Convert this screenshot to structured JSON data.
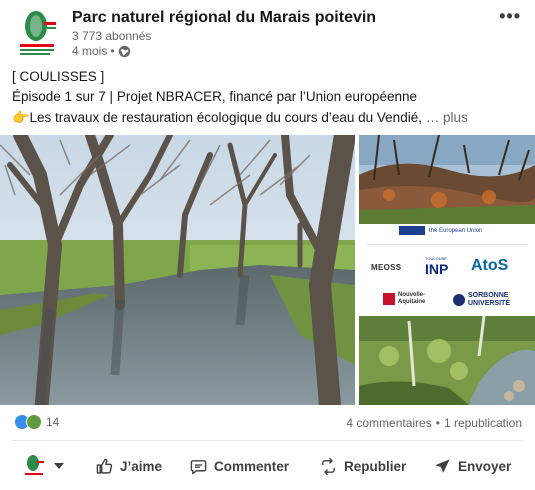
{
  "post": {
    "author": "Parc naturel régional du Marais poitevin",
    "followers": "3 773 abonnés",
    "age": "4 mois",
    "age_sep": "•",
    "more_label": "•••",
    "text_lines": [
      "[ COULISSES ]",
      "Épisode 1 sur 7 | Projet NBRACER, financé par l’Union européenne"
    ],
    "text_line3_emoji": "👉",
    "text_line3": "Les travaux de restauration écologique du cours d’eau du Vendié,",
    "see_more": "… plus"
  },
  "media": {
    "eu_caption": "the European Union",
    "logos": {
      "meoss": "MEOSS",
      "inp": "INP",
      "inp_small": "TOULOUSE",
      "atos": "AtoS",
      "nouvelle_aquitaine": [
        "Nouvelle-",
        "Aquitaine"
      ],
      "sorbonne": [
        "SORBONNE",
        "UNIVERSITÉ"
      ]
    }
  },
  "social": {
    "reaction_count": "14",
    "comments": "4 commentaires",
    "dot": "•",
    "reposts": "1 republication"
  },
  "actions": {
    "like": "J’aime",
    "comment": "Commenter",
    "repost": "Republier",
    "send": "Envoyer"
  },
  "colors": {
    "reaction_like": "#378fe9",
    "reaction_support": "#5f9b41",
    "text_secondary": "#666666"
  }
}
